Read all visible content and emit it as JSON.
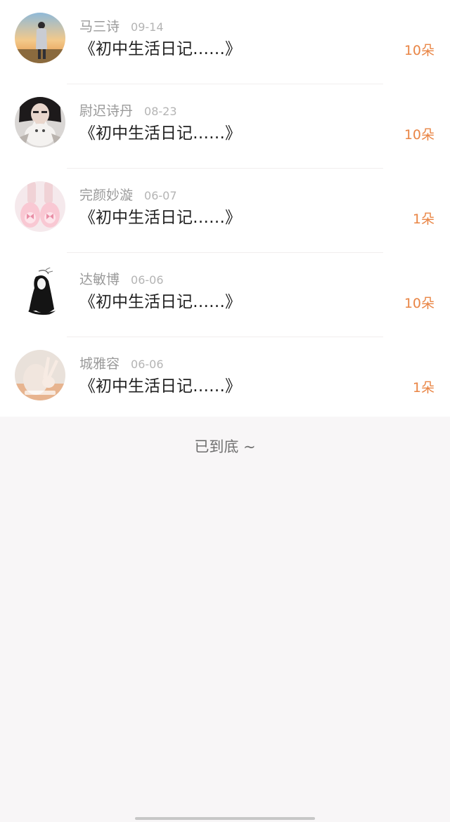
{
  "items": [
    {
      "name": "马三诗",
      "date": "09-14",
      "title": "《初中生活日记……》",
      "count": "10朵",
      "avatar_icon": "sunset-girl-avatar"
    },
    {
      "name": "尉迟诗丹",
      "date": "08-23",
      "title": "《初中生活日记……》",
      "count": "10朵",
      "avatar_icon": "girl-with-cat-avatar"
    },
    {
      "name": "完颜妙漩",
      "date": "06-07",
      "title": "《初中生活日记……》",
      "count": "1朵",
      "avatar_icon": "pink-slippers-avatar"
    },
    {
      "name": "达敏博",
      "date": "06-06",
      "title": "《初中生活日记……》",
      "count": "10朵",
      "avatar_icon": "sketch-girl-avatar"
    },
    {
      "name": "城雅容",
      "date": "06-06",
      "title": "《初中生活日记……》",
      "count": "1朵",
      "avatar_icon": "peace-sign-avatar"
    }
  ],
  "footer": {
    "end_text": "已到底 ~"
  },
  "colors": {
    "count": "#e98545",
    "page_bg": "#f8f6f7"
  }
}
